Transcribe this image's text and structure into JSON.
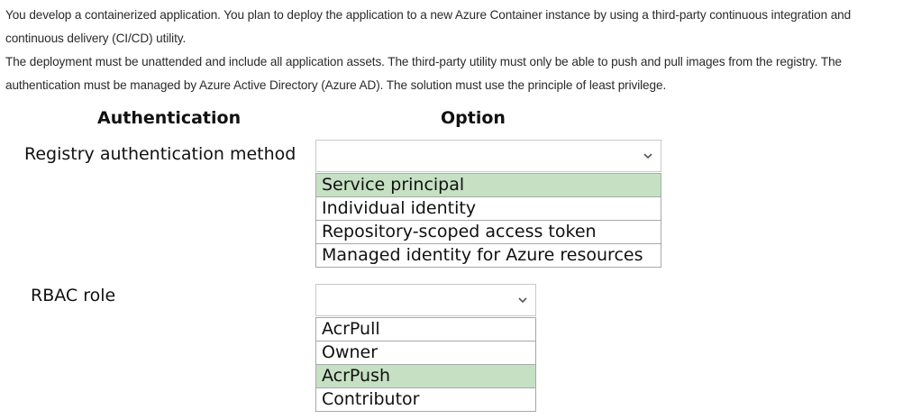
{
  "intro": {
    "line1": "You develop a containerized application. You plan to deploy the application to a new Azure Container instance by using a third-party continuous integration and continuous delivery (CI/CD) utility.",
    "line2": "The deployment must be unattended and include all application assets. The third-party utility must only be able to push and pull images from the registry. The authentication must be managed by Azure Active Directory (Azure AD). The solution must use the principle of least privilege."
  },
  "table": {
    "header_authentication": "Authentication",
    "header_option": "Option"
  },
  "registry": {
    "label": "Registry authentication method",
    "selected_value": "",
    "options": [
      {
        "label": "Service principal",
        "highlighted": true
      },
      {
        "label": "Individual identity",
        "highlighted": false
      },
      {
        "label": "Repository-scoped access token",
        "highlighted": false
      },
      {
        "label": "Managed identity for Azure resources",
        "highlighted": false
      }
    ]
  },
  "rbac": {
    "label": "RBAC role",
    "selected_value": "",
    "options": [
      {
        "label": "AcrPull",
        "highlighted": false
      },
      {
        "label": "Owner",
        "highlighted": false
      },
      {
        "label": "AcrPush",
        "highlighted": true
      },
      {
        "label": "Contributor",
        "highlighted": false
      }
    ]
  },
  "colors": {
    "highlight": "#c6e0c4",
    "border": "#a8a8a8"
  },
  "icons": {
    "dropdown": "chevron-down-icon"
  }
}
